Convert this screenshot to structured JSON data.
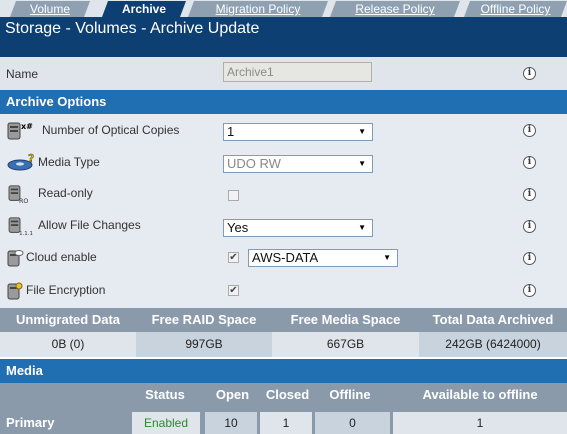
{
  "tabs": [
    {
      "label": "Volume",
      "active": false
    },
    {
      "label": "Archive",
      "active": true
    },
    {
      "label": "Migration Policy",
      "active": false
    },
    {
      "label": "Release Policy",
      "active": false
    },
    {
      "label": "Offline Policy",
      "active": false
    }
  ],
  "title": "Storage - Volumes - Archive Update",
  "name_row": {
    "label": "Name",
    "value": "Archive1"
  },
  "archive_options": {
    "header": "Archive Options",
    "optical_copies": {
      "label": "Number of Optical Copies",
      "value": "1"
    },
    "media_type": {
      "label": "Media Type",
      "value": "UDO RW"
    },
    "read_only": {
      "label": "Read-only",
      "checked": false
    },
    "allow_file_changes": {
      "label": "Allow File Changes",
      "value": "Yes"
    },
    "cloud_enable": {
      "label": "Cloud enable",
      "checked": true,
      "value": "AWS-DATA"
    },
    "file_encryption": {
      "label": "File Encryption",
      "checked": true
    }
  },
  "stats": {
    "headers": [
      "Unmigrated Data",
      "Free RAID Space",
      "Free Media Space",
      "Total Data Archived"
    ],
    "values": [
      "0B (0)",
      "997GB",
      "667GB",
      "242GB (6424000)"
    ]
  },
  "media": {
    "header": "Media",
    "columns": [
      "Status",
      "Open",
      "Closed",
      "Offline",
      "Available to offline"
    ],
    "rows": [
      {
        "name": "Primary",
        "status": "Enabled",
        "open": "10",
        "closed": "1",
        "offline": "0",
        "available": "1"
      }
    ]
  },
  "info_glyph": "i",
  "checkmark_glyph": "✔",
  "dropdown_glyph": "▼",
  "colors": {
    "title_bg": "#0d3f73",
    "section_bg": "#1f6fb2",
    "row_bg": "#e6ebf1",
    "table_head_bg": "#8a9aab",
    "status_enabled": "#2a8a2a"
  }
}
